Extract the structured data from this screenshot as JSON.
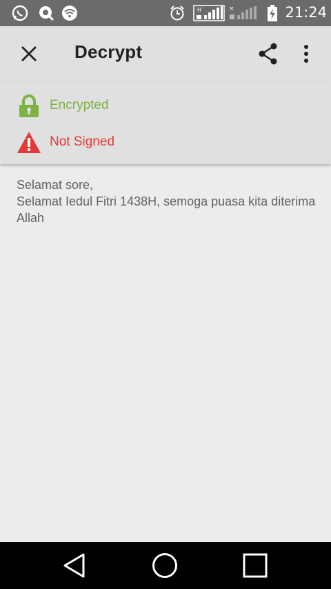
{
  "status_bar": {
    "time": "21:24",
    "icons": [
      "whatsapp-icon",
      "notification-icon",
      "wifi-icon",
      "alarm-icon",
      "signal-h-icon",
      "signal-icon",
      "battery-charging-icon"
    ]
  },
  "app_bar": {
    "title": "Decrypt"
  },
  "verification": {
    "encrypted_label": "Encrypted",
    "encrypted_color": "#7cb342",
    "signed_label": "Not Signed",
    "signed_color": "#e53935"
  },
  "message": {
    "lines": [
      "Selamat sore,",
      "Selamat Iedul Fitri 1438H, semoga puasa kita diterima Allah"
    ]
  }
}
